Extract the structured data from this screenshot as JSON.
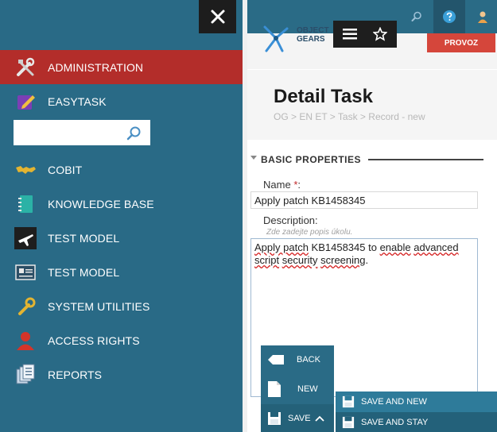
{
  "nav": {
    "items": [
      {
        "label": "ADMINISTRATION",
        "icon": "tools-icon",
        "active": true
      },
      {
        "label": "EASYTASK",
        "icon": "edit-icon"
      },
      {
        "label": "COBIT",
        "icon": "world-map-icon"
      },
      {
        "label": "KNOWLEDGE BASE",
        "icon": "notebook-icon"
      },
      {
        "label": "TEST MODEL",
        "icon": "airplane-icon"
      },
      {
        "label": "TEST MODEL",
        "icon": "id-card-icon"
      },
      {
        "label": "SYSTEM UTILITIES",
        "icon": "wrench-icon"
      },
      {
        "label": "ACCESS RIGHTS",
        "icon": "user-icon"
      },
      {
        "label": "REPORTS",
        "icon": "reports-icon"
      }
    ],
    "search_placeholder": ""
  },
  "header": {
    "logo_line1": "OBJECT",
    "logo_line2": "GEARS",
    "env_label": "PROVOZ"
  },
  "page": {
    "title": "Detail Task",
    "breadcrumb": "OG > EN ET > Task > Record - new"
  },
  "form": {
    "section_title": "BASIC PROPERTIES",
    "name_label": "Name",
    "required_mark": "*",
    "name_colon": ":",
    "name_value": "Apply patch KB1458345",
    "description_label": "Description:",
    "description_hint": "Zde zadejte popis úkolu.",
    "description_parts": [
      "Apply patch",
      " KB1458345 to ",
      "enable",
      " ",
      "advanced",
      " ",
      "script",
      " ",
      "security",
      " ",
      "screening",
      "."
    ]
  },
  "actions": {
    "back": "BACK",
    "new": "NEW",
    "save": "SAVE",
    "save_and_new": "SAVE AND NEW",
    "save_and_stay": "SAVE AND STAY"
  },
  "colors": {
    "nav_bg": "#296a86",
    "active_bg": "#b32d2a",
    "env_badge": "#d5463b"
  }
}
